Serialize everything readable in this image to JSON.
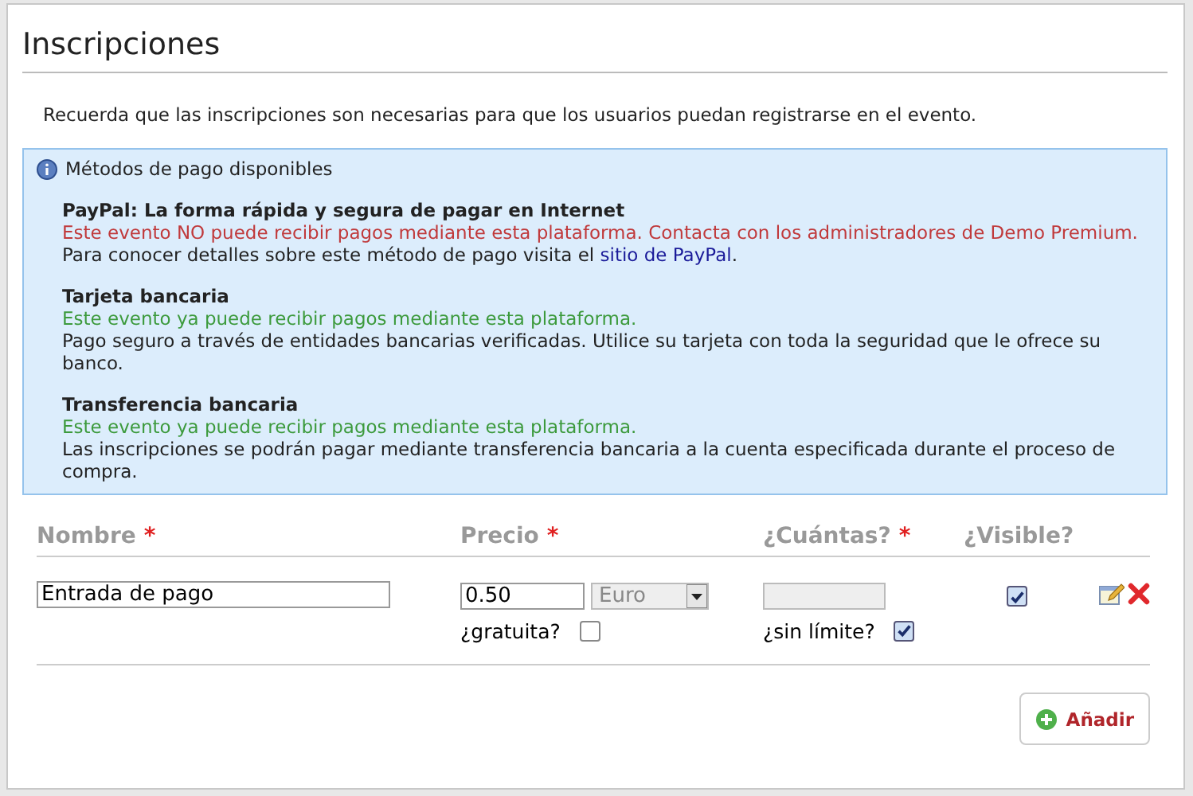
{
  "title": "Inscripciones",
  "intro": "Recuerda que las inscripciones son necesarias para que los usuarios puedan registrarse en el evento.",
  "payment_info": {
    "heading": "Métodos de pago disponibles",
    "methods": [
      {
        "name": "PayPal: La forma rápida y segura de pagar en Internet",
        "status": {
          "kind": "error",
          "text": "Este evento NO puede recibir pagos mediante esta plataforma. Contacta con los administradores de Demo Premium."
        },
        "description": "Para conocer detalles sobre este método de pago visita el ",
        "link": "sitio de PayPal",
        "description_end": "."
      },
      {
        "name": "Tarjeta bancaria",
        "status": {
          "kind": "ok",
          "text": "Este evento ya puede recibir pagos mediante esta plataforma."
        },
        "description": "Pago seguro a través de entidades bancarias verificadas. Utilice su tarjeta con toda la seguridad que le ofrece su banco."
      },
      {
        "name": "Transferencia bancaria",
        "status": {
          "kind": "ok",
          "text": "Este evento ya puede recibir pagos mediante esta plataforma."
        },
        "description": "Las inscripciones se podrán pagar mediante transferencia bancaria a la cuenta especificada durante el proceso de compra."
      }
    ]
  },
  "table": {
    "columns": [
      {
        "label": "Nombre",
        "required": true
      },
      {
        "label": "Precio",
        "required": true
      },
      {
        "label": "¿Cuántas?",
        "required": true
      },
      {
        "label": "¿Visible?",
        "required": false
      }
    ],
    "required_mark": "*",
    "rows": [
      {
        "name": "Entrada de pago",
        "price": "0.50",
        "currency": "Euro",
        "free": {
          "label": "¿gratuita?",
          "checked": false
        },
        "quantity": {
          "disabled": true
        },
        "unlimited": {
          "label": "¿sin límite?",
          "checked": true
        },
        "visible": {
          "checked": true
        }
      }
    ]
  },
  "add_button": "Añadir"
}
